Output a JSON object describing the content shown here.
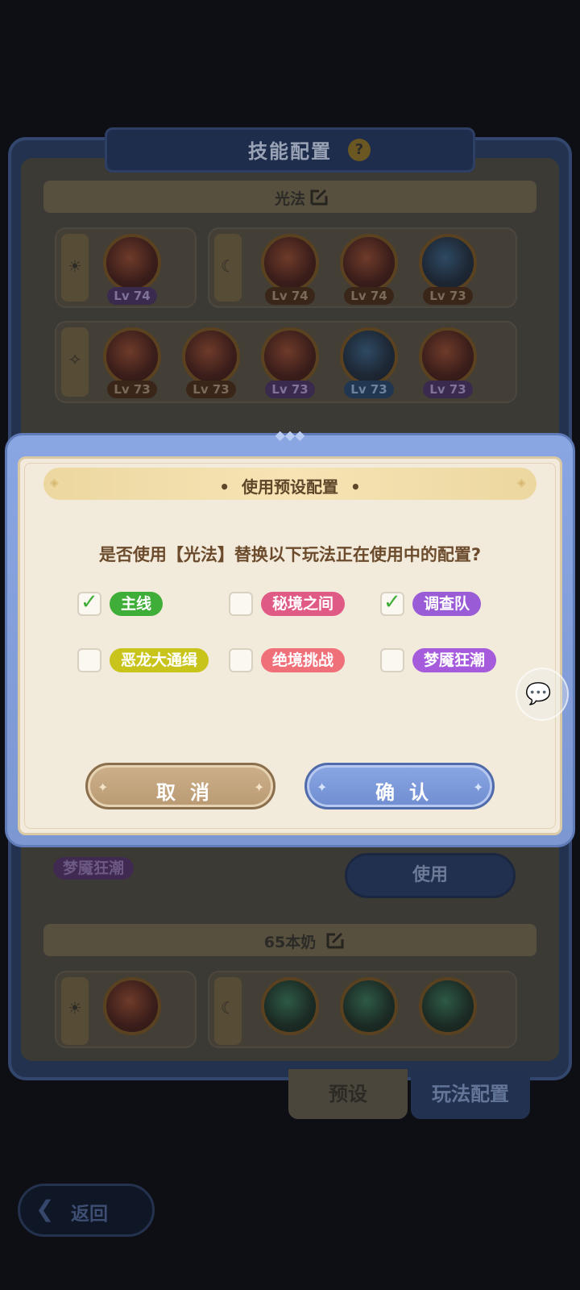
{
  "background": {
    "panel_title": "技能配置",
    "help_icon": "?",
    "preset1": {
      "name": "光法",
      "row1": [
        {
          "level": "Lv 74",
          "color": "purple"
        },
        {
          "level": "Lv 74",
          "color": "brown"
        },
        {
          "level": "Lv 74",
          "color": "brown"
        },
        {
          "level": "Lv 73",
          "color": "brown"
        }
      ],
      "row2": [
        {
          "level": "Lv 73",
          "color": "brown"
        },
        {
          "level": "Lv 73",
          "color": "brown"
        },
        {
          "level": "Lv 73",
          "color": "purple"
        },
        {
          "level": "Lv 73",
          "color": "blue"
        },
        {
          "level": "Lv 73",
          "color": "purple"
        }
      ],
      "mode_chip": "梦魇狂潮",
      "use_button": "使用"
    },
    "preset2": {
      "name": "65本奶"
    },
    "tabs": {
      "preset": "预设",
      "mode_config": "玩法配置"
    },
    "back_button": "返回"
  },
  "modal": {
    "title": "使用预设配置",
    "title_dot": "•",
    "question": "是否使用【光法】替换以下玩法正在使用中的配置?",
    "options": [
      {
        "label": "主线",
        "checked": true,
        "color": "#3fae38"
      },
      {
        "label": "秘境之间",
        "checked": false,
        "color": "#e05a86"
      },
      {
        "label": "调查队",
        "checked": true,
        "color": "#9a5bd6"
      },
      {
        "label": "恶龙大通缉",
        "checked": false,
        "color": "#c9c41c"
      },
      {
        "label": "绝境挑战",
        "checked": false,
        "color": "#f0707a"
      },
      {
        "label": "梦魇狂潮",
        "checked": false,
        "color": "#a55bdc"
      }
    ],
    "cancel_button": "取消",
    "confirm_button": "确认",
    "check_glyph": "✓"
  }
}
